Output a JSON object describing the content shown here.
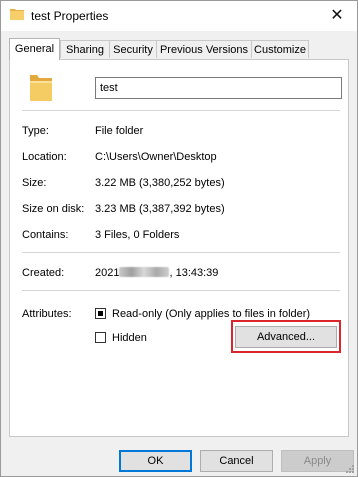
{
  "window": {
    "title": "test Properties",
    "close_glyph": "✕"
  },
  "tabs": [
    {
      "label": "General",
      "active": true
    },
    {
      "label": "Sharing",
      "active": false
    },
    {
      "label": "Security",
      "active": false
    },
    {
      "label": "Previous Versions",
      "active": false
    },
    {
      "label": "Customize",
      "active": false
    }
  ],
  "general": {
    "name_value": "test",
    "type_label": "Type:",
    "type_value": "File folder",
    "location_label": "Location:",
    "location_value": "C:\\Users\\Owner\\Desktop",
    "size_label": "Size:",
    "size_value": "3.22 MB (3,380,252 bytes)",
    "size_on_disk_label": "Size on disk:",
    "size_on_disk_value": "3.23 MB (3,387,392 bytes)",
    "contains_label": "Contains:",
    "contains_value": "3 Files, 0 Folders",
    "created_label": "Created:",
    "created_prefix": "2021",
    "created_suffix": ", 13:43:39",
    "attributes_label": "Attributes:",
    "readonly_label": "Read-only (Only applies to files in folder)",
    "readonly_checked": true,
    "hidden_label": "Hidden",
    "hidden_checked": false,
    "advanced_label": "Advanced..."
  },
  "footer": {
    "ok_label": "OK",
    "cancel_label": "Cancel",
    "apply_label": "Apply"
  },
  "colors": {
    "highlight": "#d9262c",
    "folder": "#f2c55c",
    "accent": "#0078d7"
  },
  "icons": {
    "title": "folder-icon",
    "panel": "folder-icon",
    "close": "close-icon"
  }
}
